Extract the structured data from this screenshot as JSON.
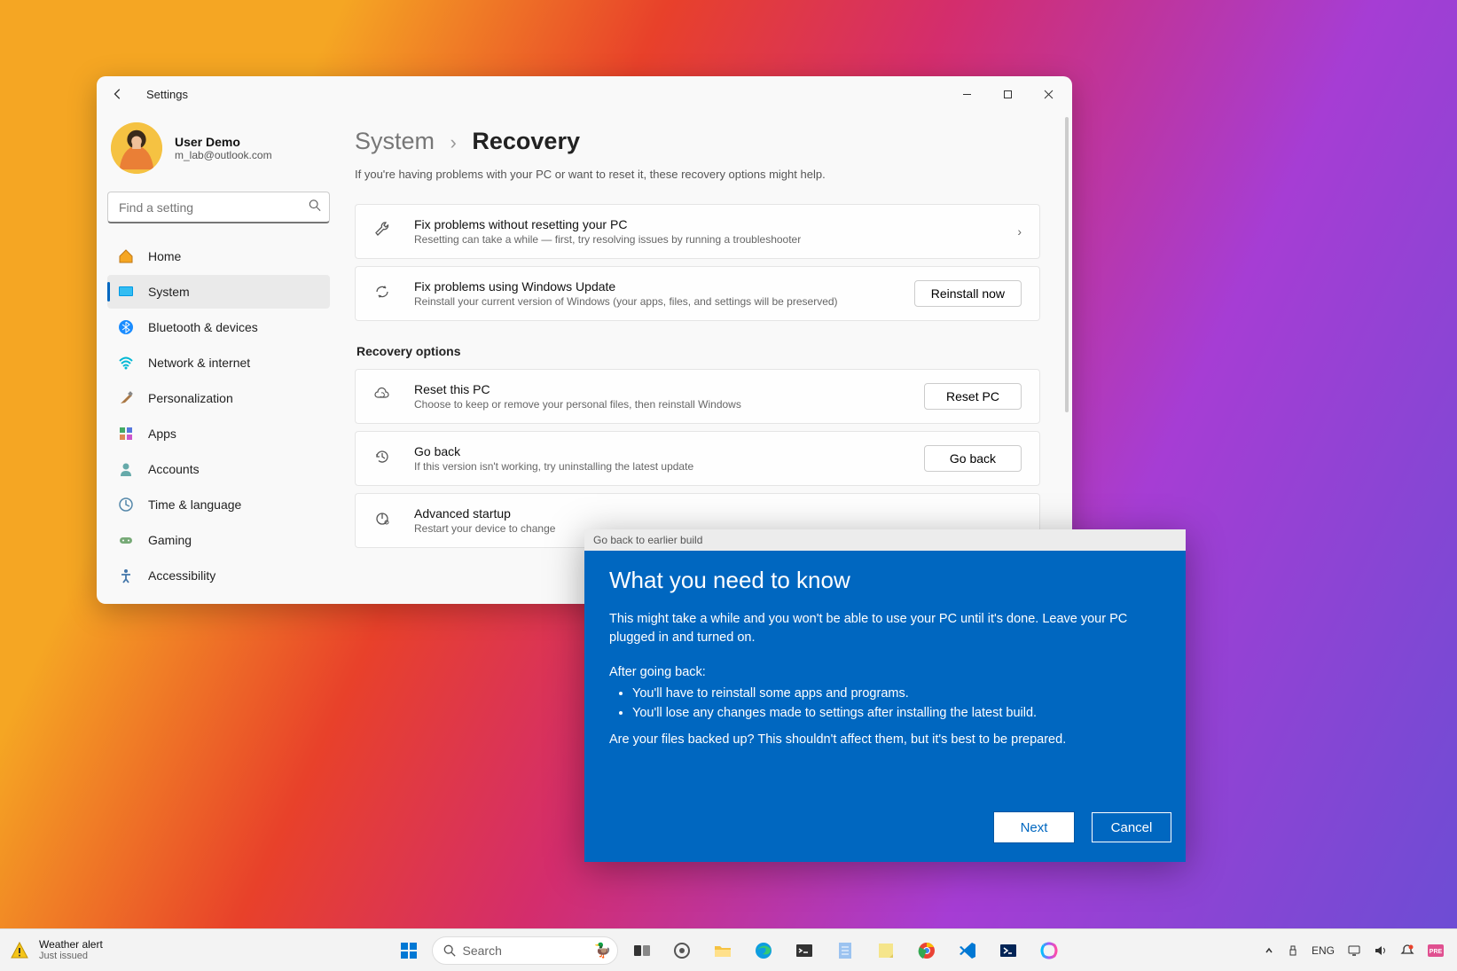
{
  "window": {
    "title": "Settings",
    "user": {
      "name": "User Demo",
      "email": "m_lab@outlook.com"
    },
    "search_placeholder": "Find a setting",
    "nav": [
      {
        "label": "Home"
      },
      {
        "label": "System"
      },
      {
        "label": "Bluetooth & devices"
      },
      {
        "label": "Network & internet"
      },
      {
        "label": "Personalization"
      },
      {
        "label": "Apps"
      },
      {
        "label": "Accounts"
      },
      {
        "label": "Time & language"
      },
      {
        "label": "Gaming"
      },
      {
        "label": "Accessibility"
      }
    ],
    "breadcrumb": {
      "parent": "System",
      "current": "Recovery"
    },
    "subtitle": "If you're having problems with your PC or want to reset it, these recovery options might help.",
    "cards_top": [
      {
        "title": "Fix problems without resetting your PC",
        "desc": "Resetting can take a while — first, try resolving issues by running a troubleshooter",
        "action_type": "chevron"
      },
      {
        "title": "Fix problems using Windows Update",
        "desc": "Reinstall your current version of Windows (your apps, files, and settings will be preserved)",
        "action_type": "button",
        "action_label": "Reinstall now"
      }
    ],
    "section_heading": "Recovery options",
    "cards_recovery": [
      {
        "title": "Reset this PC",
        "desc": "Choose to keep or remove your personal files, then reinstall Windows",
        "action_label": "Reset PC"
      },
      {
        "title": "Go back",
        "desc": "If this version isn't working, try uninstalling the latest update",
        "action_label": "Go back"
      },
      {
        "title": "Advanced startup",
        "desc": "Restart your device to change",
        "action_label": ""
      }
    ]
  },
  "modal": {
    "titlebar": "Go back to earlier build",
    "heading": "What you need to know",
    "paragraph": "This might take a while and you won't be able to use your PC until it's done. Leave your PC plugged in and turned on.",
    "after_label": "After going back:",
    "bullets": [
      "You'll have to reinstall some apps and programs.",
      "You'll lose any changes made to settings after installing the latest build."
    ],
    "closing": "Are your files backed up? This shouldn't affect them, but it's best to be prepared.",
    "next": "Next",
    "cancel": "Cancel"
  },
  "taskbar": {
    "weather": {
      "line1": "Weather alert",
      "line2": "Just issued"
    },
    "search_placeholder": "Search",
    "tray": {
      "lang": "ENG"
    }
  }
}
